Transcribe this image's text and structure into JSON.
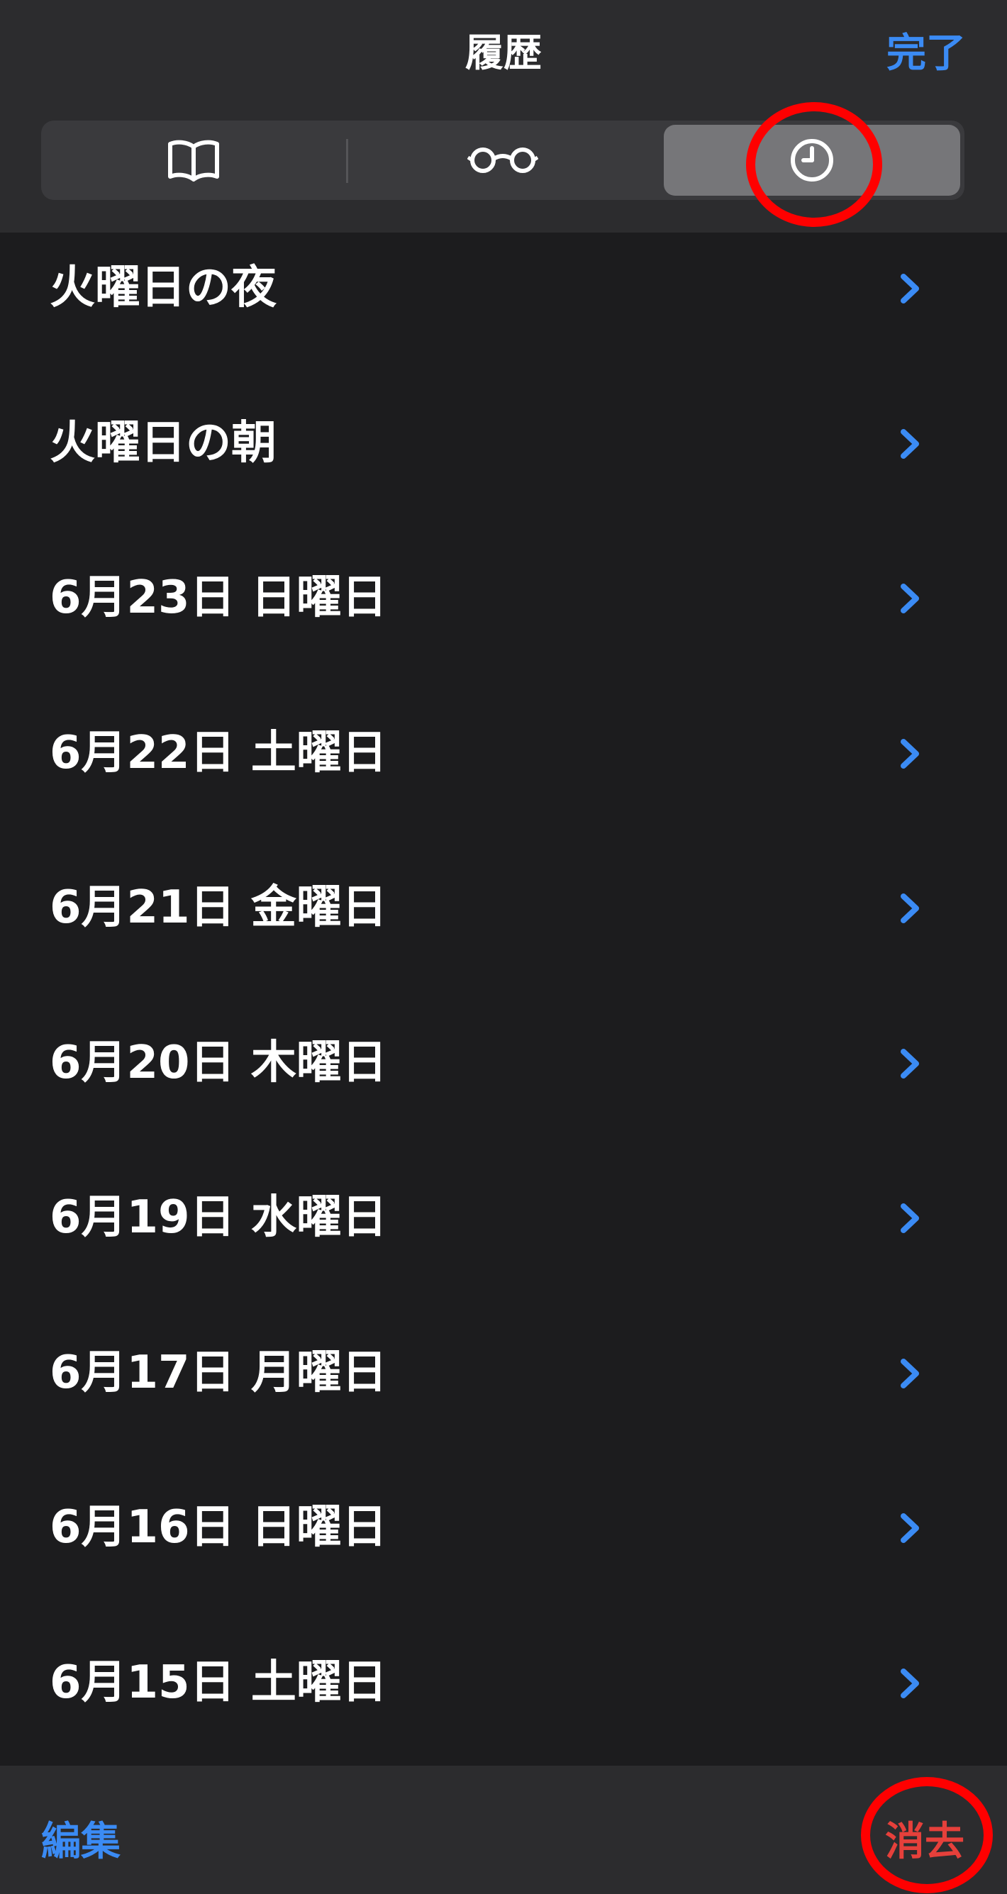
{
  "header": {
    "title": "履歴",
    "done_label": "完了"
  },
  "segments": [
    {
      "icon": "book-icon",
      "selected": false
    },
    {
      "icon": "glasses-icon",
      "selected": false
    },
    {
      "icon": "clock-icon",
      "selected": true
    }
  ],
  "history": [
    {
      "label": "火曜日の夜"
    },
    {
      "label": "火曜日の朝"
    },
    {
      "label": "6月23日 日曜日"
    },
    {
      "label": "6月22日 土曜日"
    },
    {
      "label": "6月21日 金曜日"
    },
    {
      "label": "6月20日 木曜日"
    },
    {
      "label": "6月19日 水曜日"
    },
    {
      "label": "6月17日 月曜日"
    },
    {
      "label": "6月16日 日曜日"
    },
    {
      "label": "6月15日 土曜日"
    }
  ],
  "toolbar": {
    "edit_label": "編集",
    "clear_label": "消去"
  },
  "colors": {
    "accent": "#3b8bf4",
    "destructive": "#e6403b",
    "annotation": "#ff0000",
    "background": "#1c1c1e"
  }
}
